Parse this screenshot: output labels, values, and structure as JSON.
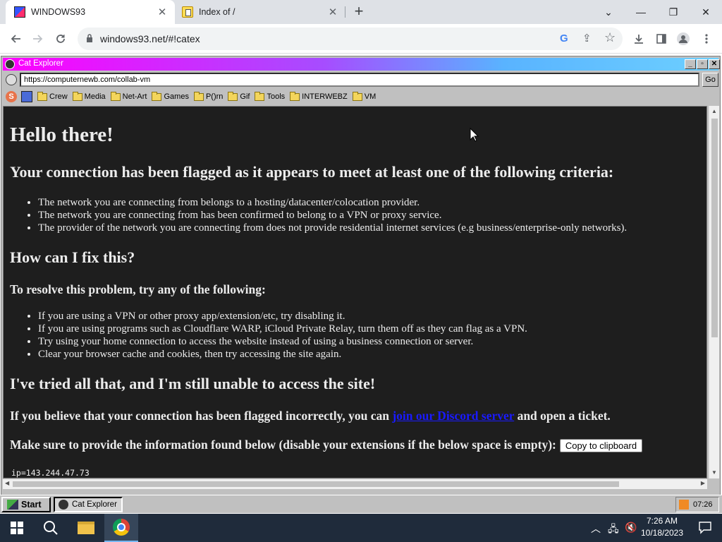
{
  "browser": {
    "tabs": [
      {
        "title": "WINDOWS93",
        "close": "✕"
      },
      {
        "title": "Index of /",
        "close": "✕"
      }
    ],
    "new_tab": "+",
    "window_controls": {
      "dropdown": "⌄",
      "minimize": "—",
      "maximize": "❐",
      "close": "✕"
    },
    "url": "windows93.net/#!catex",
    "omnibox_g": "G"
  },
  "cat_explorer": {
    "title": "Cat Explorer",
    "titlebar_buttons": [
      "_",
      "▫",
      "✕"
    ],
    "address": "https://computernewb.com/collab-vm",
    "go_label": "Go",
    "bookmarks": [
      "Crew",
      "Media",
      "Net-Art",
      "Games",
      "P()rn",
      "Gif",
      "Tools",
      "INTERWEBZ",
      "VM"
    ],
    "page": {
      "heading": "Hello there!",
      "flagged_heading": "Your connection has been flagged as it appears to meet at least one of the following criteria:",
      "criteria": [
        "The network you are connecting from belongs to a hosting/datacenter/colocation provider.",
        "The network you are connecting from has been confirmed to belong to a VPN or proxy service.",
        "The provider of the network you are connecting from does not provide residential internet services (e.g business/enterprise-only networks)."
      ],
      "fix_heading": "How can I fix this?",
      "resolve_heading": "To resolve this problem, try any of the following:",
      "fixes": [
        "If you are using a VPN or other proxy app/extension/etc, try disabling it.",
        "If you are using programs such as Cloudflare WARP, iCloud Private Relay, turn them off as they can flag as a VPN.",
        "Try using your home connection to access the website instead of using a business connection or server.",
        "Clear your browser cache and cookies, then try accessing the site again."
      ],
      "tried_heading": "I've tried all that, and I'm still unable to access the site!",
      "ticket_before": "If you believe that your connection has been flagged incorrectly, you can ",
      "ticket_link": "join our Discord server",
      "ticket_after": " and open a ticket.",
      "info_text": "Make sure to provide the information found below (disable your extensions if the below space is empty):",
      "copy_button": "Copy to clipboard",
      "ip_line": "ip=143.244.47.73"
    }
  },
  "w93_taskbar": {
    "start": "Start",
    "task": "Cat Explorer",
    "clock": "07:26"
  },
  "w10_taskbar": {
    "time": "7:26 AM",
    "date": "10/18/2023"
  }
}
